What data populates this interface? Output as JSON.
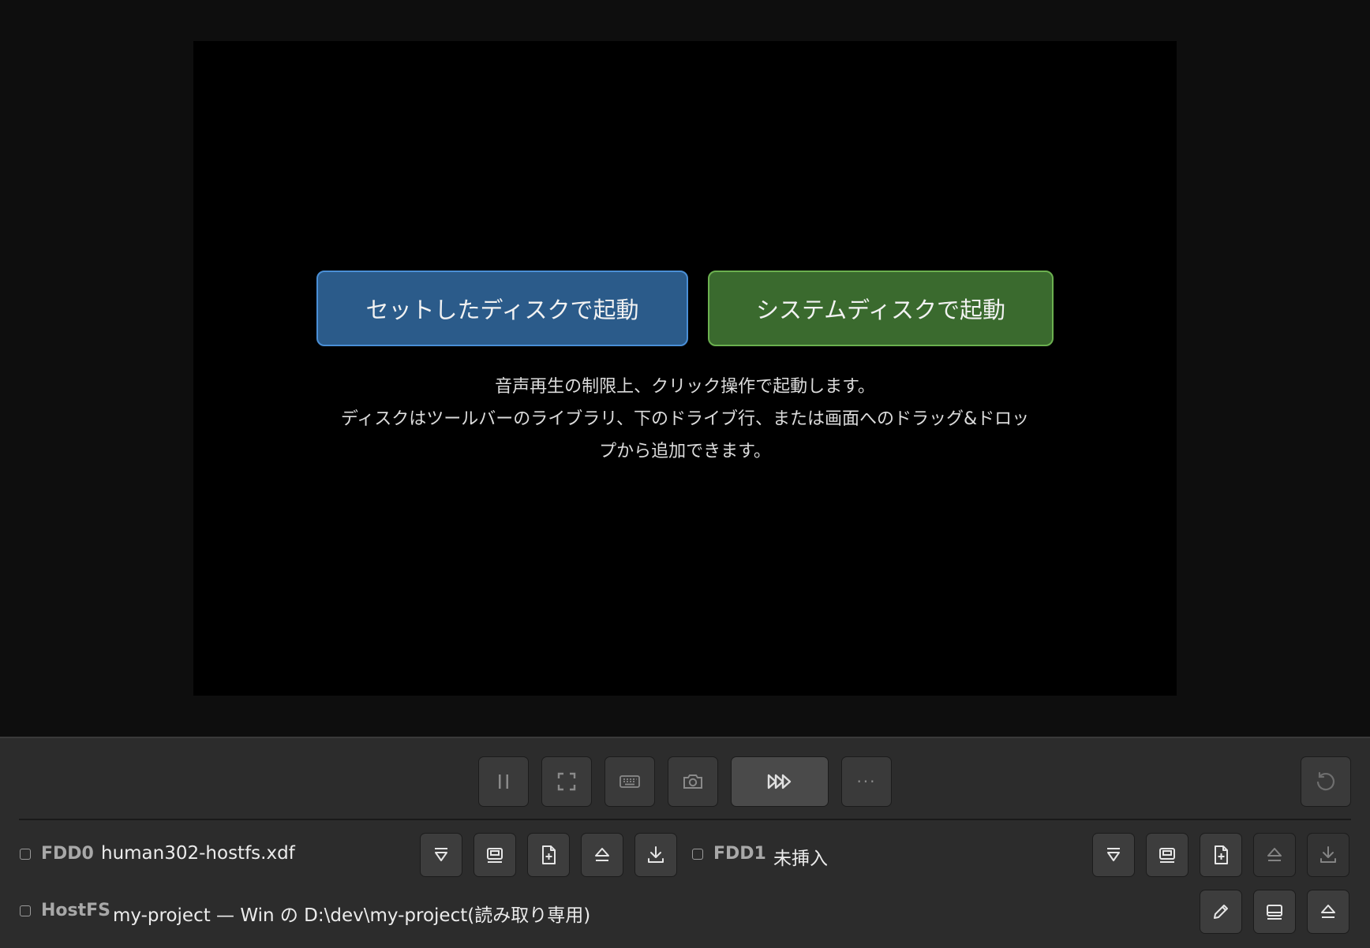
{
  "boot": {
    "set_disk_label": "セットしたディスクで起動",
    "system_disk_label": "システムディスクで起動",
    "hint_line1": "音声再生の制限上、クリック操作で起動します。",
    "hint_line2": "ディスクはツールバーのライブラリ、下のドライブ行、または画面へのドラッグ&ドロッ",
    "hint_line3": "プから追加できます。"
  },
  "toolbar": {
    "buttons": [
      "pause-icon",
      "fullscreen-icon",
      "keyboard-icon",
      "camera-icon",
      "fast-forward-icon",
      "more-icon",
      "reset-icon"
    ],
    "more_label": "···"
  },
  "drives": {
    "fdd0": {
      "label": "FDD0",
      "name": "human302-hostfs.xdf"
    },
    "fdd1": {
      "label": "FDD1",
      "name": "未挿入"
    },
    "hostfs": {
      "label": "HostFS",
      "name": "my-project — Win の D:\\dev\\my-project(読み取り専用)"
    }
  },
  "colors": {
    "boot_blue": "#2b5b8a",
    "boot_green": "#3a6a2e",
    "panel_bg": "#2c2c2c"
  }
}
